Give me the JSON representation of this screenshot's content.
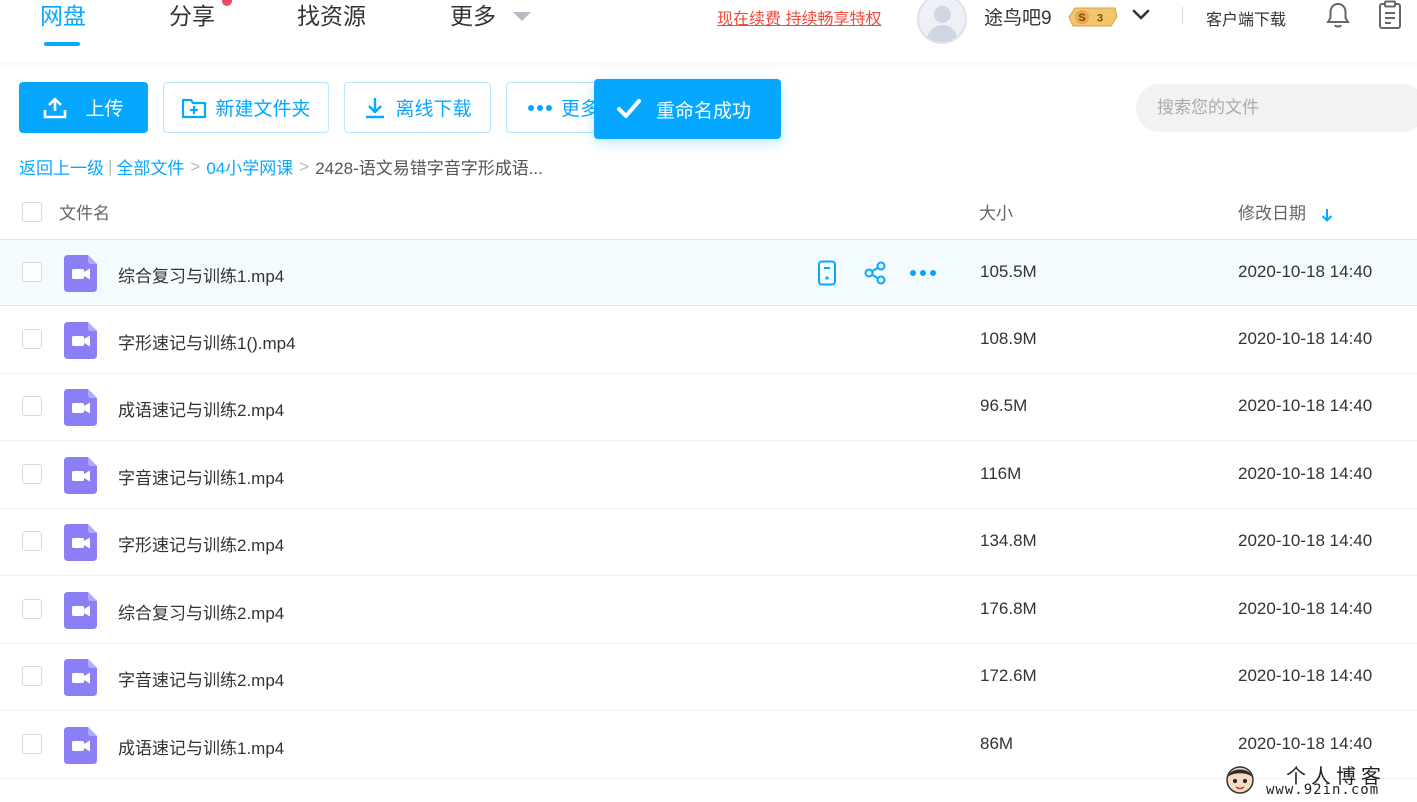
{
  "nav": {
    "items": [
      {
        "label": "网盘",
        "active": true
      },
      {
        "label": "分享",
        "has_dot": true
      },
      {
        "label": "找资源"
      },
      {
        "label": "更多"
      }
    ],
    "promo": "现在续费 持续畅享特权",
    "username": "途鸟吧9",
    "vip_level": "3",
    "vip_letter": "S",
    "client_download": "客户端下载",
    "icons": [
      "bell-icon",
      "clipboard-icon",
      "chevron-down-icon",
      "avatar"
    ]
  },
  "toolbar": {
    "upload": "上传",
    "new_folder": "新建文件夹",
    "offline_download": "离线下载",
    "more": "更多",
    "toast": "重命名成功",
    "search_placeholder": "搜索您的文件"
  },
  "breadcrumb": {
    "back": "返回上一级",
    "all_files": "全部文件",
    "folder": "04小学网课",
    "current": "2428-语文易错字音字形成语...",
    "separator": ">"
  },
  "table": {
    "columns": {
      "name": "文件名",
      "size": "大小",
      "date": "修改日期"
    },
    "sort": {
      "column": "date",
      "direction": "desc"
    },
    "rows": [
      {
        "name": "综合复习与训练1.mp4",
        "size": "105.5M",
        "date": "2020-10-18 14:40",
        "hover": true
      },
      {
        "name": "字形速记与训练1().mp4",
        "size": "108.9M",
        "date": "2020-10-18 14:40"
      },
      {
        "name": "成语速记与训练2.mp4",
        "size": "96.5M",
        "date": "2020-10-18 14:40"
      },
      {
        "name": "字音速记与训练1.mp4",
        "size": "116M",
        "date": "2020-10-18 14:40"
      },
      {
        "name": "字形速记与训练2.mp4",
        "size": "134.8M",
        "date": "2020-10-18 14:40"
      },
      {
        "name": "综合复习与训练2.mp4",
        "size": "176.8M",
        "date": "2020-10-18 14:40"
      },
      {
        "name": "字音速记与训练2.mp4",
        "size": "172.6M",
        "date": "2020-10-18 14:40"
      },
      {
        "name": "成语速记与训练1.mp4",
        "size": "86M",
        "date": "2020-10-18 14:40"
      }
    ]
  },
  "watermark": {
    "title": "个人博客",
    "url": "www.92in.com"
  },
  "colors": {
    "accent": "#06a7ff",
    "promo": "#f24b3c",
    "video_icon": "#8b7ff6"
  }
}
